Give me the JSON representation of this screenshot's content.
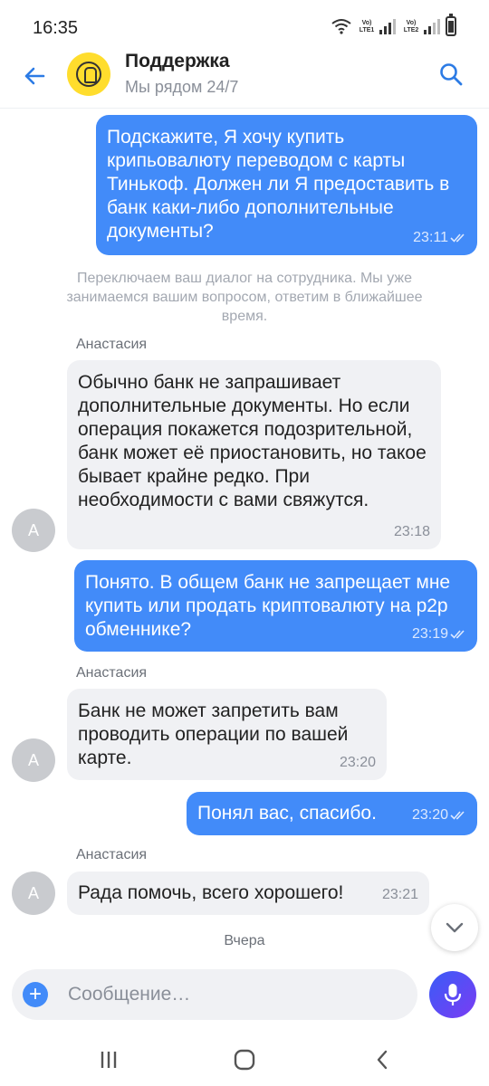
{
  "status": {
    "time": "16:35",
    "sim1": "Vo) LTE1",
    "sim2": "Vo) LTE2"
  },
  "header": {
    "title": "Поддержка",
    "subtitle": "Мы рядом 24/7"
  },
  "messages": [
    {
      "dir": "out",
      "text": "Подскажите, Я хочу купить крипьовалюту переводом с карты Тинькоф. Должен ли Я предоставить в банк каки-либо дополнительные документы?",
      "time": "23:11"
    },
    {
      "dir": "system",
      "text": "Переключаем ваш диалог на сотрудника. Мы уже занимаемся вашим вопросом, ответим в ближайшее время."
    },
    {
      "dir": "in",
      "sender": "Анастасия",
      "avatar": "А",
      "text": "Обычно банк не запрашивает дополнительные документы. Но если операция покажется подозрительной, банк может её приостановить, но такое бывает крайне редко. При необходимости с вами свяжутся.",
      "time": "23:18"
    },
    {
      "dir": "out",
      "text": "Понято. В общем банк не запрещает мне купить или продать криптовалюту на р2р обменнике?",
      "time": "23:19"
    },
    {
      "dir": "in",
      "sender": "Анастасия",
      "avatar": "А",
      "text": "Банк не может запретить вам проводить операции по вашей карте.",
      "time": "23:20"
    },
    {
      "dir": "out",
      "text": "Понял вас, спасибо.",
      "time": "23:20"
    },
    {
      "dir": "in",
      "sender": "Анастасия",
      "avatar": "А",
      "text": "Рада помочь, всего хорошего!",
      "time": "23:21"
    }
  ],
  "day_label": "Вчера",
  "input": {
    "placeholder": "Сообщение…"
  },
  "icons": {
    "back": "arrow-left-icon",
    "search": "search-icon",
    "plus": "plus-icon",
    "mic": "microphone-icon",
    "scroll": "chevron-down-icon",
    "nav_recent": "recent-apps-icon",
    "nav_home": "home-icon",
    "nav_back": "back-icon"
  },
  "colors": {
    "accent": "#428bf9",
    "incoming_bg": "#f0f1f4",
    "brand_yellow": "#ffdd2d"
  }
}
